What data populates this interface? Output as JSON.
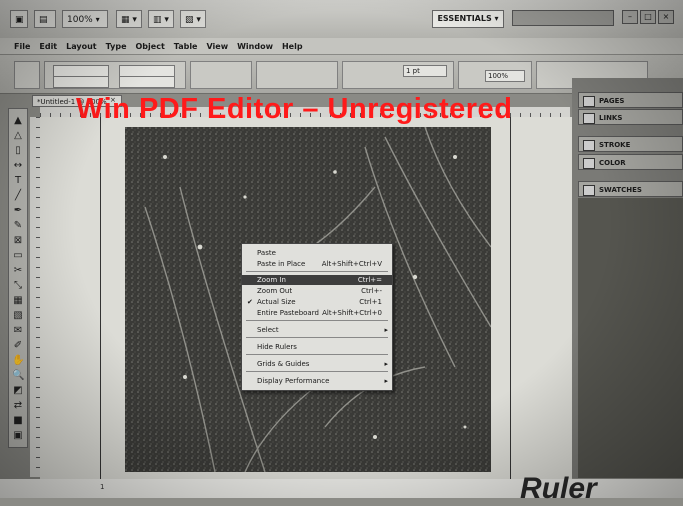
{
  "appbar": {
    "zoom": "100%",
    "workspace": "ESSENTIALS",
    "window_controls": [
      "–",
      "□",
      "×"
    ]
  },
  "menubar": [
    "File",
    "Edit",
    "Layout",
    "Type",
    "Object",
    "Table",
    "View",
    "Window",
    "Help"
  ],
  "controlbar": {
    "stroke_weight": "1 pt",
    "opacity": "100%"
  },
  "document_tab": {
    "title": "*Untitled-1 @ 100%",
    "close": "×"
  },
  "tools": [
    "selection-icon",
    "direct-selection-icon",
    "page-icon",
    "gap-icon",
    "type-icon",
    "line-icon",
    "pen-icon",
    "pencil-icon",
    "rectangle-frame-icon",
    "rectangle-icon",
    "scissors-icon",
    "free-transform-icon",
    "gradient-swatch-icon",
    "gradient-feather-icon",
    "note-icon",
    "eyedropper-icon",
    "hand-icon",
    "zoom-icon",
    "fill-stroke-icon",
    "swap-icon",
    "apply-color-icon",
    "view-mode-icon"
  ],
  "tool_glyphs": [
    "▲",
    "△",
    "▯",
    "↔",
    "T",
    "╱",
    "✒",
    "✎",
    "⊠",
    "▭",
    "✂",
    "⤡",
    "▦",
    "▧",
    "✉",
    "✐",
    "✋",
    "🔍",
    "◩",
    "⇄",
    "■",
    "▣"
  ],
  "panels": [
    {
      "label": "PAGES",
      "icon": "pages-icon"
    },
    {
      "label": "LINKS",
      "icon": "links-icon"
    },
    {
      "label": "STROKE",
      "icon": "stroke-icon"
    },
    {
      "label": "COLOR",
      "icon": "color-icon"
    },
    {
      "label": "SWATCHES",
      "icon": "swatches-icon"
    }
  ],
  "context_menu": {
    "items": [
      {
        "label": "Paste",
        "shortcut": "",
        "check": "",
        "arrow": ""
      },
      {
        "label": "Paste in Place",
        "shortcut": "Alt+Shift+Ctrl+V",
        "check": "",
        "arrow": ""
      },
      {
        "label": "Zoom In",
        "shortcut": "Ctrl+=",
        "check": "",
        "arrow": "",
        "highlight": true
      },
      {
        "label": "Zoom Out",
        "shortcut": "Ctrl+-",
        "check": "",
        "arrow": ""
      },
      {
        "label": "Actual Size",
        "shortcut": "Ctrl+1",
        "check": "✔",
        "arrow": ""
      },
      {
        "label": "Entire Pasteboard",
        "shortcut": "Alt+Shift+Ctrl+0",
        "check": "",
        "arrow": ""
      },
      {
        "label": "Select",
        "shortcut": "",
        "check": "",
        "arrow": "▸"
      },
      {
        "label": "Hide Rulers",
        "shortcut": "",
        "check": "",
        "arrow": ""
      },
      {
        "label": "Grids & Guides",
        "shortcut": "",
        "check": "",
        "arrow": "▸"
      },
      {
        "label": "Display Performance",
        "shortcut": "",
        "check": "",
        "arrow": "▸"
      }
    ]
  },
  "watermark": "Win PDF Editor – Unregistered",
  "statusbar": {
    "page": "1"
  },
  "paper_caption": "Ruler"
}
